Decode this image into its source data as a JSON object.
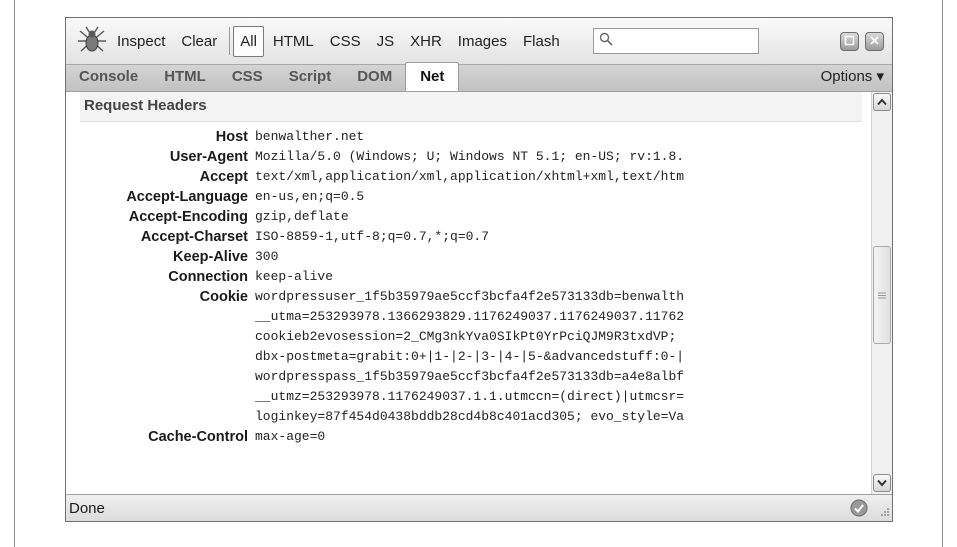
{
  "toolbar": {
    "buttons": [
      "Inspect",
      "Clear"
    ],
    "filters": [
      "All",
      "HTML",
      "CSS",
      "JS",
      "XHR",
      "Images",
      "Flash"
    ],
    "selected_filter": "All",
    "search_value": ""
  },
  "tabs": [
    "Console",
    "HTML",
    "CSS",
    "Script",
    "DOM",
    "Net"
  ],
  "active_tab": "Net",
  "options_label": "Options ▾",
  "section_title": "Request Headers",
  "headers": [
    {
      "name": "Host",
      "value": "benwalther.net"
    },
    {
      "name": "User-Agent",
      "value": "Mozilla/5.0 (Windows; U; Windows NT 5.1; en-US; rv:1.8."
    },
    {
      "name": "Accept",
      "value": "text/xml,application/xml,application/xhtml+xml,text/htm"
    },
    {
      "name": "Accept-Language",
      "value": "en-us,en;q=0.5"
    },
    {
      "name": "Accept-Encoding",
      "value": "gzip,deflate"
    },
    {
      "name": "Accept-Charset",
      "value": "ISO-8859-1,utf-8;q=0.7,*;q=0.7"
    },
    {
      "name": "Keep-Alive",
      "value": "300"
    },
    {
      "name": "Connection",
      "value": "keep-alive"
    },
    {
      "name": "Cookie",
      "value": "wordpressuser_1f5b35979ae5ccf3bcfa4f2e573133db=benwalth"
    },
    {
      "name": "",
      "value": "__utma=253293978.1366293829.1176249037.1176249037.11762"
    },
    {
      "name": "",
      "value": "cookieb2evosession=2_CMg3nkYva0SIkPt0YrPciQJM9R3txdVP;"
    },
    {
      "name": "",
      "value": "dbx-postmeta=grabit:0+|1-|2-|3-|4-|5-&advancedstuff:0-|"
    },
    {
      "name": "",
      "value": "wordpresspass_1f5b35979ae5ccf3bcfa4f2e573133db=a4e8albf"
    },
    {
      "name": "",
      "value": "__utmz=253293978.1176249037.1.1.utmccn=(direct)|utmcsr="
    },
    {
      "name": "",
      "value": "loginkey=87f454d0438bddb28cd4b8c401acd305; evo_style=Va"
    },
    {
      "name": "Cache-Control",
      "value": "max-age=0"
    }
  ],
  "status": "Done",
  "colors": {
    "window_bg": "#ececec",
    "content_bg": "#ffffff",
    "tab_active_bg": "#ffffff"
  }
}
